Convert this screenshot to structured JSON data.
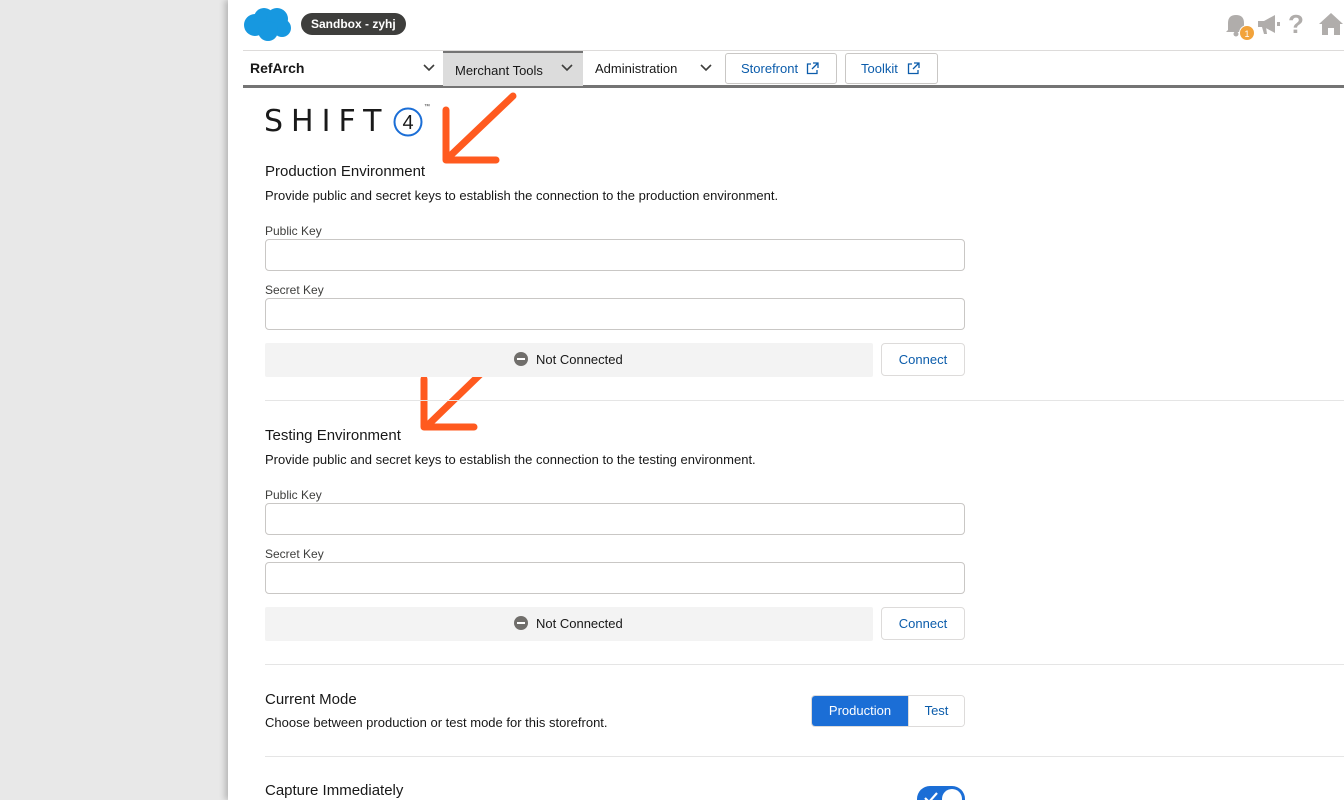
{
  "header": {
    "sandbox_label": "Sandbox - zyhj",
    "notification_count": "1",
    "help_glyph": "?"
  },
  "nav": {
    "site": "RefArch",
    "merchant_tools": "Merchant Tools",
    "administration": "Administration",
    "storefront": "Storefront",
    "toolkit": "Toolkit"
  },
  "logo": {
    "text": "SHIFT",
    "digit": "4",
    "tm": "™"
  },
  "production": {
    "title": "Production Environment",
    "description": "Provide public and secret keys to establish the connection to the production environment.",
    "public_key_label": "Public Key",
    "public_key_value": "",
    "secret_key_label": "Secret Key",
    "secret_key_value": "",
    "status": "Not Connected",
    "connect_label": "Connect"
  },
  "testing": {
    "title": "Testing Environment",
    "description": "Provide public and secret keys to establish the connection to the testing environment.",
    "public_key_label": "Public Key",
    "public_key_value": "",
    "secret_key_label": "Secret Key",
    "secret_key_value": "",
    "status": "Not Connected",
    "connect_label": "Connect"
  },
  "mode": {
    "title": "Current Mode",
    "description": "Choose between production or test mode for this storefront.",
    "production_label": "Production",
    "test_label": "Test",
    "selected": "Production"
  },
  "capture": {
    "title": "Capture Immediately",
    "enabled": true
  },
  "colors": {
    "brand_blue": "#1b6ed6",
    "link_blue": "#0b5cab",
    "annotation_arrow": "#ff5a1f",
    "badge": "#f2a33b"
  },
  "icons": [
    "salesforce-cloud-icon",
    "bell-icon",
    "megaphone-icon",
    "help-icon",
    "home-icon",
    "chevron-down-icon",
    "external-link-icon",
    "minus-circle-icon",
    "check-icon"
  ]
}
